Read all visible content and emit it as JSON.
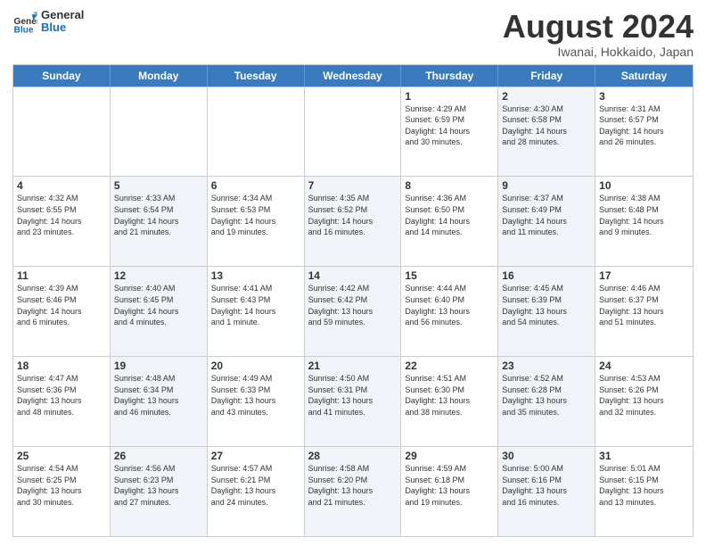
{
  "logo": {
    "line1": "General",
    "line2": "Blue"
  },
  "title": "August 2024",
  "subtitle": "Iwanai, Hokkaido, Japan",
  "headers": [
    "Sunday",
    "Monday",
    "Tuesday",
    "Wednesday",
    "Thursday",
    "Friday",
    "Saturday"
  ],
  "rows": [
    [
      {
        "num": "",
        "info": "",
        "shaded": false,
        "empty": true
      },
      {
        "num": "",
        "info": "",
        "shaded": false,
        "empty": true
      },
      {
        "num": "",
        "info": "",
        "shaded": false,
        "empty": true
      },
      {
        "num": "",
        "info": "",
        "shaded": false,
        "empty": true
      },
      {
        "num": "1",
        "info": "Sunrise: 4:29 AM\nSunset: 6:59 PM\nDaylight: 14 hours\nand 30 minutes.",
        "shaded": false
      },
      {
        "num": "2",
        "info": "Sunrise: 4:30 AM\nSunset: 6:58 PM\nDaylight: 14 hours\nand 28 minutes.",
        "shaded": true
      },
      {
        "num": "3",
        "info": "Sunrise: 4:31 AM\nSunset: 6:57 PM\nDaylight: 14 hours\nand 26 minutes.",
        "shaded": false
      }
    ],
    [
      {
        "num": "4",
        "info": "Sunrise: 4:32 AM\nSunset: 6:55 PM\nDaylight: 14 hours\nand 23 minutes.",
        "shaded": false
      },
      {
        "num": "5",
        "info": "Sunrise: 4:33 AM\nSunset: 6:54 PM\nDaylight: 14 hours\nand 21 minutes.",
        "shaded": true
      },
      {
        "num": "6",
        "info": "Sunrise: 4:34 AM\nSunset: 6:53 PM\nDaylight: 14 hours\nand 19 minutes.",
        "shaded": false
      },
      {
        "num": "7",
        "info": "Sunrise: 4:35 AM\nSunset: 6:52 PM\nDaylight: 14 hours\nand 16 minutes.",
        "shaded": true
      },
      {
        "num": "8",
        "info": "Sunrise: 4:36 AM\nSunset: 6:50 PM\nDaylight: 14 hours\nand 14 minutes.",
        "shaded": false
      },
      {
        "num": "9",
        "info": "Sunrise: 4:37 AM\nSunset: 6:49 PM\nDaylight: 14 hours\nand 11 minutes.",
        "shaded": true
      },
      {
        "num": "10",
        "info": "Sunrise: 4:38 AM\nSunset: 6:48 PM\nDaylight: 14 hours\nand 9 minutes.",
        "shaded": false
      }
    ],
    [
      {
        "num": "11",
        "info": "Sunrise: 4:39 AM\nSunset: 6:46 PM\nDaylight: 14 hours\nand 6 minutes.",
        "shaded": false
      },
      {
        "num": "12",
        "info": "Sunrise: 4:40 AM\nSunset: 6:45 PM\nDaylight: 14 hours\nand 4 minutes.",
        "shaded": true
      },
      {
        "num": "13",
        "info": "Sunrise: 4:41 AM\nSunset: 6:43 PM\nDaylight: 14 hours\nand 1 minute.",
        "shaded": false
      },
      {
        "num": "14",
        "info": "Sunrise: 4:42 AM\nSunset: 6:42 PM\nDaylight: 13 hours\nand 59 minutes.",
        "shaded": true
      },
      {
        "num": "15",
        "info": "Sunrise: 4:44 AM\nSunset: 6:40 PM\nDaylight: 13 hours\nand 56 minutes.",
        "shaded": false
      },
      {
        "num": "16",
        "info": "Sunrise: 4:45 AM\nSunset: 6:39 PM\nDaylight: 13 hours\nand 54 minutes.",
        "shaded": true
      },
      {
        "num": "17",
        "info": "Sunrise: 4:46 AM\nSunset: 6:37 PM\nDaylight: 13 hours\nand 51 minutes.",
        "shaded": false
      }
    ],
    [
      {
        "num": "18",
        "info": "Sunrise: 4:47 AM\nSunset: 6:36 PM\nDaylight: 13 hours\nand 48 minutes.",
        "shaded": false
      },
      {
        "num": "19",
        "info": "Sunrise: 4:48 AM\nSunset: 6:34 PM\nDaylight: 13 hours\nand 46 minutes.",
        "shaded": true
      },
      {
        "num": "20",
        "info": "Sunrise: 4:49 AM\nSunset: 6:33 PM\nDaylight: 13 hours\nand 43 minutes.",
        "shaded": false
      },
      {
        "num": "21",
        "info": "Sunrise: 4:50 AM\nSunset: 6:31 PM\nDaylight: 13 hours\nand 41 minutes.",
        "shaded": true
      },
      {
        "num": "22",
        "info": "Sunrise: 4:51 AM\nSunset: 6:30 PM\nDaylight: 13 hours\nand 38 minutes.",
        "shaded": false
      },
      {
        "num": "23",
        "info": "Sunrise: 4:52 AM\nSunset: 6:28 PM\nDaylight: 13 hours\nand 35 minutes.",
        "shaded": true
      },
      {
        "num": "24",
        "info": "Sunrise: 4:53 AM\nSunset: 6:26 PM\nDaylight: 13 hours\nand 32 minutes.",
        "shaded": false
      }
    ],
    [
      {
        "num": "25",
        "info": "Sunrise: 4:54 AM\nSunset: 6:25 PM\nDaylight: 13 hours\nand 30 minutes.",
        "shaded": false
      },
      {
        "num": "26",
        "info": "Sunrise: 4:56 AM\nSunset: 6:23 PM\nDaylight: 13 hours\nand 27 minutes.",
        "shaded": true
      },
      {
        "num": "27",
        "info": "Sunrise: 4:57 AM\nSunset: 6:21 PM\nDaylight: 13 hours\nand 24 minutes.",
        "shaded": false
      },
      {
        "num": "28",
        "info": "Sunrise: 4:58 AM\nSunset: 6:20 PM\nDaylight: 13 hours\nand 21 minutes.",
        "shaded": true
      },
      {
        "num": "29",
        "info": "Sunrise: 4:59 AM\nSunset: 6:18 PM\nDaylight: 13 hours\nand 19 minutes.",
        "shaded": false
      },
      {
        "num": "30",
        "info": "Sunrise: 5:00 AM\nSunset: 6:16 PM\nDaylight: 13 hours\nand 16 minutes.",
        "shaded": true
      },
      {
        "num": "31",
        "info": "Sunrise: 5:01 AM\nSunset: 6:15 PM\nDaylight: 13 hours\nand 13 minutes.",
        "shaded": false
      }
    ]
  ]
}
